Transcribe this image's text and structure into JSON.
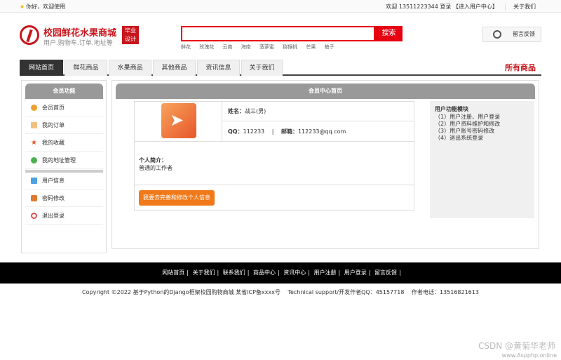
{
  "topbar": {
    "greeting": "你好，欢迎使用",
    "welcome": "欢迎 13511223344 登录",
    "user_center": "【进入用户中心】",
    "about": "关于我们"
  },
  "header": {
    "title": "校园鲜花水果商城",
    "subtitle": "用户.购物车.订单.地址等",
    "badge_line1": "毕业",
    "badge_line2": "设计",
    "search_placeholder": "",
    "search_button": "搜索",
    "hot_words": [
      "鲜花",
      "玫瑰花",
      "云南",
      "海南",
      "菠萝蜜",
      "猕猴桃",
      "芒果",
      "柚子"
    ],
    "feedback": "留言反馈"
  },
  "nav": {
    "tabs": [
      "网站首页",
      "鲜花商品",
      "水果商品",
      "其他商品",
      "资讯信息",
      "关于我们"
    ],
    "active_index": 0,
    "all_goods": "所有商品"
  },
  "sidebar": {
    "title": "会员功能",
    "items": [
      {
        "label": "会员首页",
        "icon": "home-icon",
        "color": "#f0a030"
      },
      {
        "label": "我的订单",
        "icon": "order-icon",
        "color": "#f0c080"
      },
      {
        "label": "我的收藏",
        "icon": "star-icon",
        "color": "#e8562a"
      },
      {
        "label": "我的地址管理",
        "icon": "location-icon",
        "color": "#4caf50"
      }
    ],
    "items2": [
      {
        "label": "用户信息",
        "icon": "user-info-icon",
        "color": "#4aa3df"
      },
      {
        "label": "密码修改",
        "icon": "lock-icon",
        "color": "#e07a30"
      },
      {
        "label": "退出登录",
        "icon": "power-icon",
        "color": "#e05050"
      }
    ]
  },
  "main": {
    "title": "会员中心首页",
    "name_label": "姓名：",
    "name_value": "战三(男)",
    "qq_label": "QQ：",
    "qq_value": "112233",
    "email_label": "邮箱：",
    "email_value": "112233@qq.com",
    "bio_label": "个人简介：",
    "bio_value": "普通的工作者",
    "edit_button": "我要去完善和修改个人信息"
  },
  "modules": {
    "title": "用户功能模块",
    "lines": [
      "（1）用户注册、用户登录",
      "（2）用户资料维护和修改",
      "（3）用户账号密码修改",
      "（4）退出系统登录"
    ]
  },
  "footer": {
    "links": [
      "网站首页",
      "关于我们",
      "联系我们",
      "商品中心",
      "资讯中心",
      "用户注册",
      "用户登录",
      "留言反馈"
    ],
    "copyright": "Copyright ©2022 基于Python的Django框架校园购物商城 某省ICP备xxxx号　 Technical support/开发作者QQ：45157718　 作者电话：13516821613"
  },
  "watermark": "CSDN @黄菊华老师",
  "watermark2": "www.Aspphp.online"
}
